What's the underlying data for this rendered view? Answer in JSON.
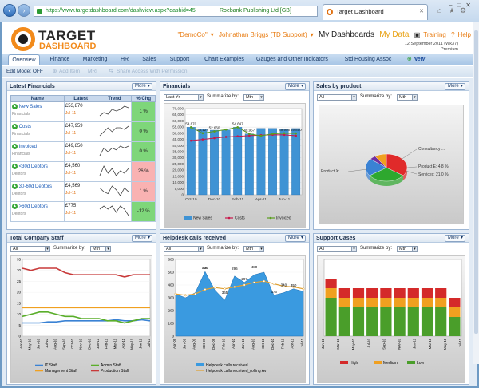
{
  "browser": {
    "url": "https://www.targetdashboard.com/dashview.aspx?dashid=45",
    "publisher": "Roebank Publishing Ltd [GB]",
    "tab_title": "Target Dashboard"
  },
  "header": {
    "logo_line1": "TARGET",
    "logo_line2": "DASHBOARD",
    "company": "\"DemoCo\"",
    "user": "Johnathan Briggs (TD Support)",
    "my_dashboards": "My Dashboards",
    "my_data": "My Data",
    "training": "Training",
    "help": "Help",
    "date_line1": "12 September 2011 (Wk37)",
    "date_line2": "Premium"
  },
  "nav": {
    "tabs": [
      "Overview",
      "Finance",
      "Marketing",
      "HR",
      "Sales",
      "Support",
      "Chart Examples",
      "Gauges and Other Indicators",
      "Std Housing Assoc Metrics"
    ],
    "new_label": "New"
  },
  "editbar": {
    "edit_mode": "Edit Mode: OFF",
    "add_item": "Add Item",
    "mru": "MRI",
    "share": "Share Access With Permission"
  },
  "common": {
    "more": "More",
    "summarize": "Summarize by:",
    "all": "All",
    "mth": "Mth",
    "last_yr": "Last Yr"
  },
  "colors": {
    "accent": "#f28a1a",
    "nav_blue": "#1b3a66",
    "positive": "#7ed67a",
    "negative": "#f9b2b2"
  },
  "latest_financials": {
    "title": "Latest Financials",
    "columns": [
      "Name",
      "Latest",
      "Trend",
      "% Chg"
    ],
    "rows": [
      {
        "name": "New Sales",
        "sub": "Financials",
        "value": "£53,870",
        "date": "Jul-11",
        "chg": "1 %",
        "status": "positive",
        "trend": [
          3,
          4,
          3.5,
          5,
          4.5,
          5,
          6,
          5.5
        ]
      },
      {
        "name": "Costs",
        "sub": "Financials",
        "value": "£47,959",
        "date": "Jul-11",
        "chg": "0 %",
        "status": "positive",
        "trend": [
          4,
          4.5,
          5,
          4.5,
          5,
          5,
          4.8,
          5.2
        ]
      },
      {
        "name": "Invoiced",
        "sub": "Financials",
        "value": "£49,850",
        "date": "Jul-11",
        "chg": "0 %",
        "status": "positive",
        "trend": [
          3,
          5,
          4,
          5,
          4.5,
          5.5,
          5,
          5.5
        ]
      },
      {
        "name": "<30d Debtors",
        "sub": "Debtors",
        "value": "£4,560",
        "date": "Jul-11",
        "chg": "26 %",
        "status": "negative",
        "trend": [
          2,
          6,
          3,
          5,
          2,
          4,
          3,
          5
        ]
      },
      {
        "name": "30-60d Debtors",
        "sub": "Debtors",
        "value": "£4,569",
        "date": "Jul-11",
        "chg": "1 %",
        "status": "negative",
        "trend": [
          5,
          3,
          2,
          6,
          4,
          1,
          5,
          3
        ]
      },
      {
        "name": ">60d Debtors",
        "sub": "Debtors",
        "value": "£775",
        "date": "Jul-11",
        "chg": "-12 %",
        "status": "positive",
        "trend": [
          5,
          6,
          5,
          6,
          4,
          6,
          5,
          3
        ]
      }
    ]
  },
  "panel_titles": {
    "financials": "Financials",
    "sales_by_product": "Sales by product",
    "total_staff": "Total Company Staff",
    "helpdesk": "Helpdesk calls received",
    "support_cases": "Support Cases"
  },
  "chart_data": [
    {
      "type": "bar",
      "title": "Financials",
      "categories": [
        "Oct-10",
        "Nov-10",
        "Dec-10",
        "Jan-11",
        "Feb-11",
        "Mar-11",
        "Apr-11",
        "May-11",
        "Jun-11",
        "Jul-11"
      ],
      "tick_labels": [
        "Oct-10",
        "Dec-10",
        "Feb-11",
        "Apr-11",
        "Jun-11"
      ],
      "ylim": [
        0,
        70000
      ],
      "yticks": [
        "0",
        "5,000",
        "10,000",
        "15,000",
        "20,000",
        "25,000",
        "30,000",
        "35,000",
        "40,000",
        "45,000",
        "50,000",
        "55,000",
        "60,000",
        "65,000",
        "70,000"
      ],
      "series": [
        {
          "name": "New Sales",
          "kind": "bar",
          "color": "#3f93d4",
          "values": [
            54870,
            53000,
            52500,
            52700,
            54870,
            49500,
            54000,
            54000,
            53000,
            53870
          ]
        },
        {
          "name": "Costs",
          "kind": "line",
          "color": "#c8174a",
          "values": [
            44000,
            45000,
            46000,
            47000,
            47500,
            48000,
            48500,
            48800,
            48700,
            47959
          ]
        },
        {
          "name": "Invoiced",
          "kind": "line",
          "color": "#5a9e1e",
          "values": [
            54870,
            50000,
            51500,
            53000,
            54870,
            49500,
            47900,
            49500,
            50000,
            49850
          ]
        }
      ],
      "data_labels": [
        "54,870",
        "53,127",
        "52,660",
        "54,647",
        "49,957",
        "49,956",
        "49,850"
      ]
    },
    {
      "type": "pie",
      "title": "Sales by product",
      "slices": [
        {
          "label": "Consultancy:...",
          "value": 35,
          "color": "#e02a2a"
        },
        {
          "label": "Product X:...",
          "value": 30,
          "color": "#2ea82e"
        },
        {
          "label": "Services: 21.0 %",
          "value": 21,
          "color": "#3a82d4"
        },
        {
          "label": "Product E: 4.8 %",
          "value": 4.8,
          "color": "#7030a0"
        },
        {
          "label": "",
          "value": 9.2,
          "color": "#f0a020"
        }
      ]
    },
    {
      "type": "line",
      "title": "Total Company Staff",
      "x": [
        "Apr-10",
        "May-10",
        "Jun-10",
        "Jul-10",
        "Aug-10",
        "Sep-10",
        "Oct-10",
        "Nov-10",
        "Dec-10",
        "Jan-11",
        "Feb-11",
        "Mar-11",
        "Apr-11",
        "May-11",
        "Jun-11",
        "Jul-11"
      ],
      "ylim": [
        0,
        35
      ],
      "yticks": [
        "0",
        "5",
        "10",
        "15",
        "20",
        "25",
        "30",
        "35"
      ],
      "series": [
        {
          "name": "IT Staff",
          "color": "#3a82d4",
          "values": [
            6,
            6,
            6,
            6.5,
            6.5,
            7,
            7,
            7,
            7,
            7,
            7,
            7.5,
            7,
            7,
            7.5,
            7
          ]
        },
        {
          "name": "Admin Staff",
          "color": "#5aae2a",
          "values": [
            9,
            10,
            11,
            11,
            10,
            9,
            9,
            8,
            8,
            8,
            7,
            7,
            6,
            7,
            8,
            8
          ]
        },
        {
          "name": "Management Staff",
          "color": "#f0a020",
          "values": [
            13,
            13,
            13,
            13,
            13,
            13,
            13,
            13,
            13,
            13,
            13,
            13,
            13,
            13,
            13,
            13
          ]
        },
        {
          "name": "Production Staff",
          "color": "#c83a3a",
          "values": [
            31,
            30,
            31,
            31,
            31,
            29,
            28,
            28,
            28,
            28,
            28,
            28,
            27,
            28,
            28,
            28
          ]
        }
      ]
    },
    {
      "type": "area",
      "title": "Helpdesk calls received",
      "x": [
        "Apr-09",
        "Jun-09",
        "Aug-09",
        "Oct-09",
        "Dec-09",
        "Feb-10",
        "Apr-10",
        "Jun-10",
        "Aug-10",
        "Oct-10",
        "Dec-10",
        "Feb-11",
        "Apr-11",
        "Jul-11"
      ],
      "ylim": [
        0,
        600
      ],
      "yticks": [
        "0",
        "100",
        "200",
        "300",
        "400",
        "500",
        "600"
      ],
      "series": [
        {
          "name": "Helpdesk calls received",
          "color": "#3a9ae0",
          "values": [
            330,
            300,
            340,
            505,
            360,
            280,
            470,
            420,
            480,
            500,
            320,
            340,
            370,
            350
          ]
        },
        {
          "name": "Helpdesk calls received_rolling Av",
          "color": "#e0a030",
          "values": [
            330,
            320,
            330,
            365,
            380,
            370,
            385,
            400,
            420,
            430,
            410,
            390,
            385,
            370
          ]
        }
      ],
      "data_labels": [
        "330",
        "365",
        "505",
        "296",
        "297",
        "480",
        "376",
        "340",
        "350"
      ]
    },
    {
      "type": "bar",
      "title": "Support Cases",
      "stacked": true,
      "x": [
        "Jan-10",
        "Mar-10",
        "May-10",
        "Jul-10",
        "Sep-10",
        "Nov-10",
        "Jan-11",
        "Mar-11",
        "May-11",
        "Jul-11"
      ],
      "ylim": [
        0,
        8
      ],
      "series": [
        {
          "name": "High",
          "color": "#d42a2a",
          "values": [
            1,
            1,
            1,
            1,
            1,
            1,
            1,
            1,
            1,
            1
          ]
        },
        {
          "name": "Medium",
          "color": "#f0a020",
          "values": [
            1,
            1,
            1,
            1,
            1,
            1,
            1,
            1,
            1,
            1
          ]
        },
        {
          "name": "Low",
          "color": "#4a9e2a",
          "values": [
            4,
            3,
            3,
            3,
            3,
            3,
            3,
            3,
            3,
            2
          ]
        }
      ]
    }
  ]
}
